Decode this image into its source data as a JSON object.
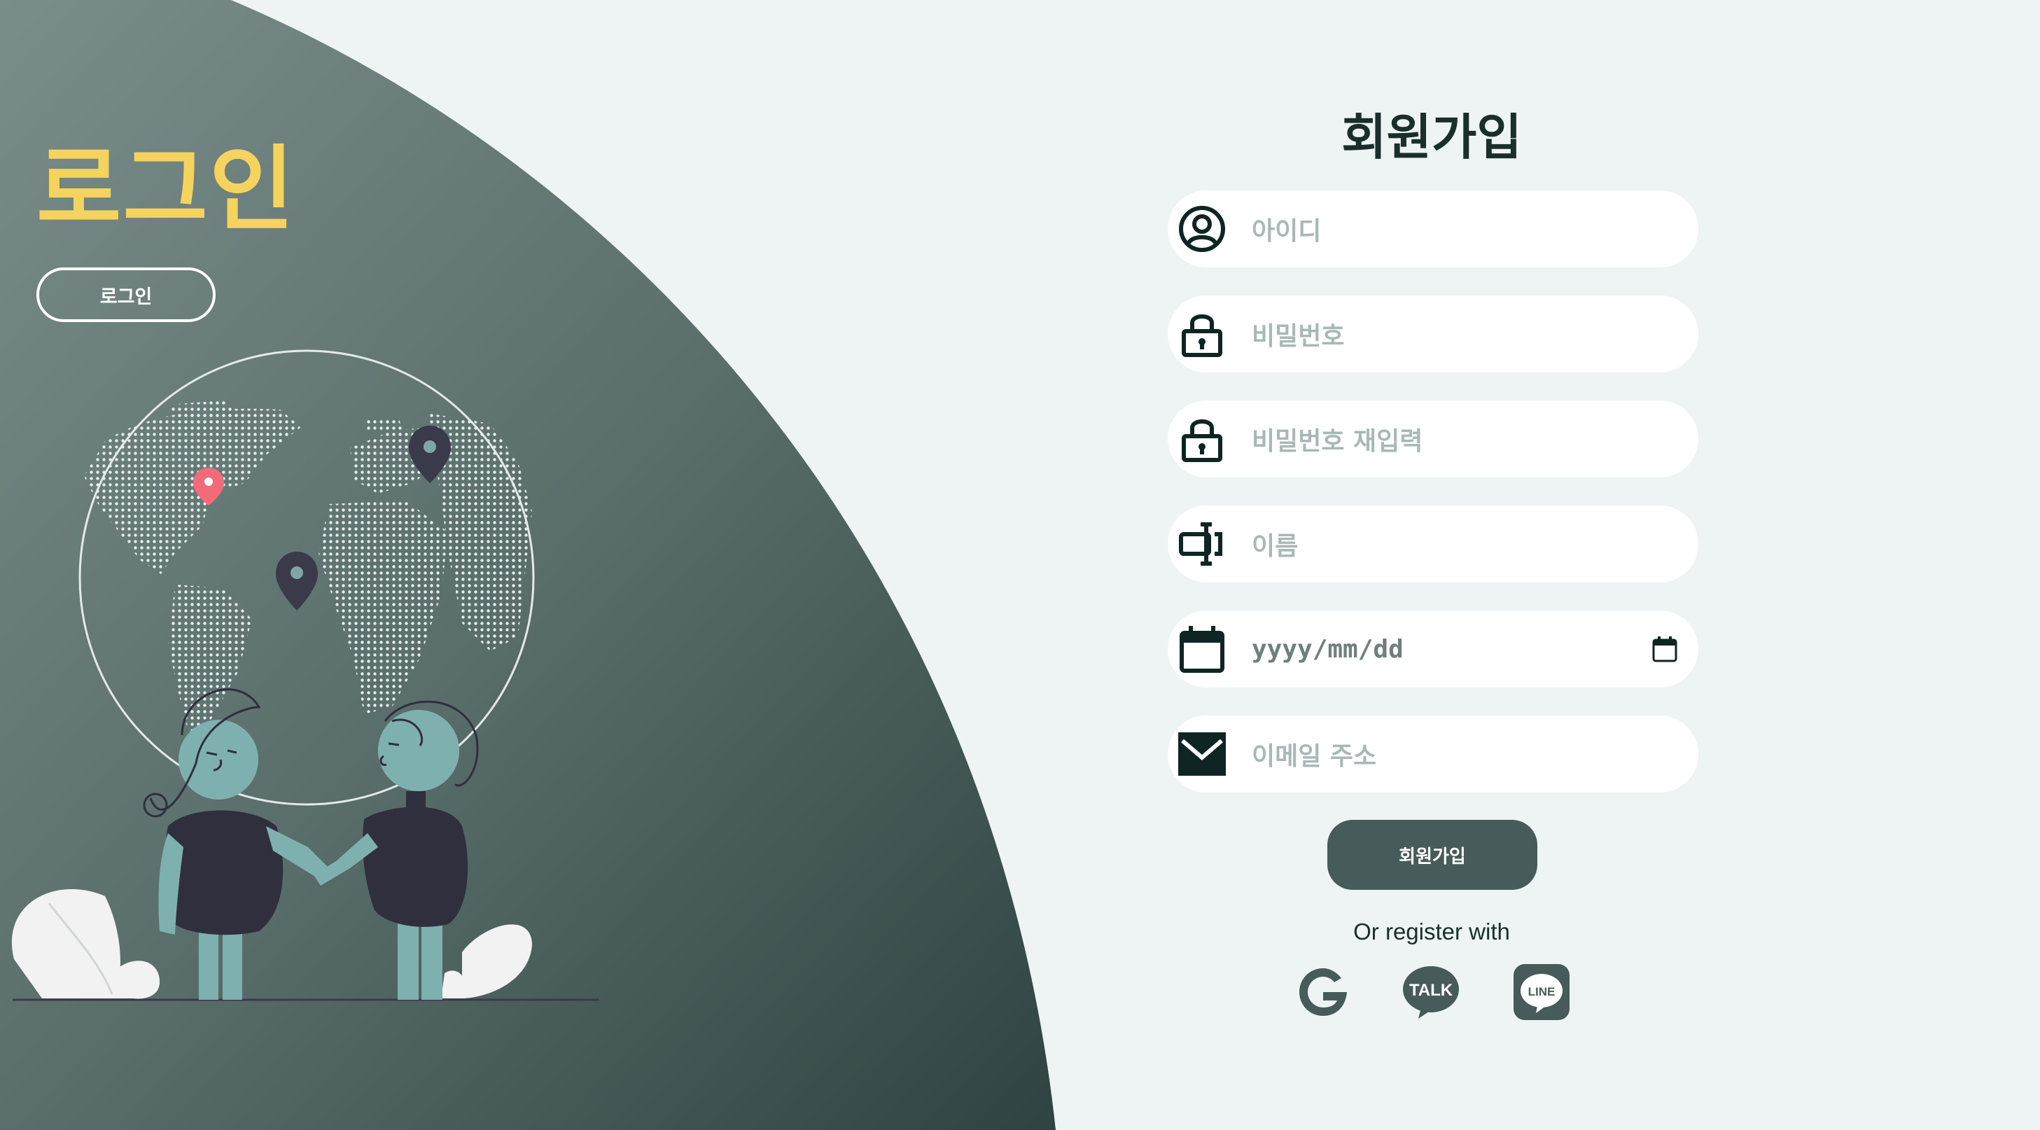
{
  "login_panel": {
    "title": "로그인",
    "button_label": "로그인"
  },
  "signup_form": {
    "title": "회원가입",
    "fields": [
      {
        "placeholder": "아이디",
        "icon": "user-circle-icon"
      },
      {
        "placeholder": "비밀번호",
        "icon": "lock-icon"
      },
      {
        "placeholder": "비밀번호 재입력",
        "icon": "lock-icon"
      },
      {
        "placeholder": "이름",
        "icon": "text-cursor-icon"
      },
      {
        "placeholder": "yyyy/mm/dd",
        "icon": "calendar-icon"
      },
      {
        "placeholder": "이메일 주소",
        "icon": "envelope-icon"
      }
    ],
    "submit_label": "회원가입",
    "or_text": "Or register with",
    "social": [
      {
        "label": "G",
        "icon": "google-icon"
      },
      {
        "label": "TALK",
        "icon": "kakao-talk-icon"
      },
      {
        "label": "LINE",
        "icon": "line-icon"
      }
    ]
  },
  "colors": {
    "accent_yellow": "#f4d35e",
    "panel_dark": "#2f4442",
    "button_bg": "#475c5a",
    "page_bg": "#eef4f4",
    "placeholder": "#a8b8b7",
    "pin_red": "#f26b7a",
    "pin_dark": "#3b3a4a"
  }
}
